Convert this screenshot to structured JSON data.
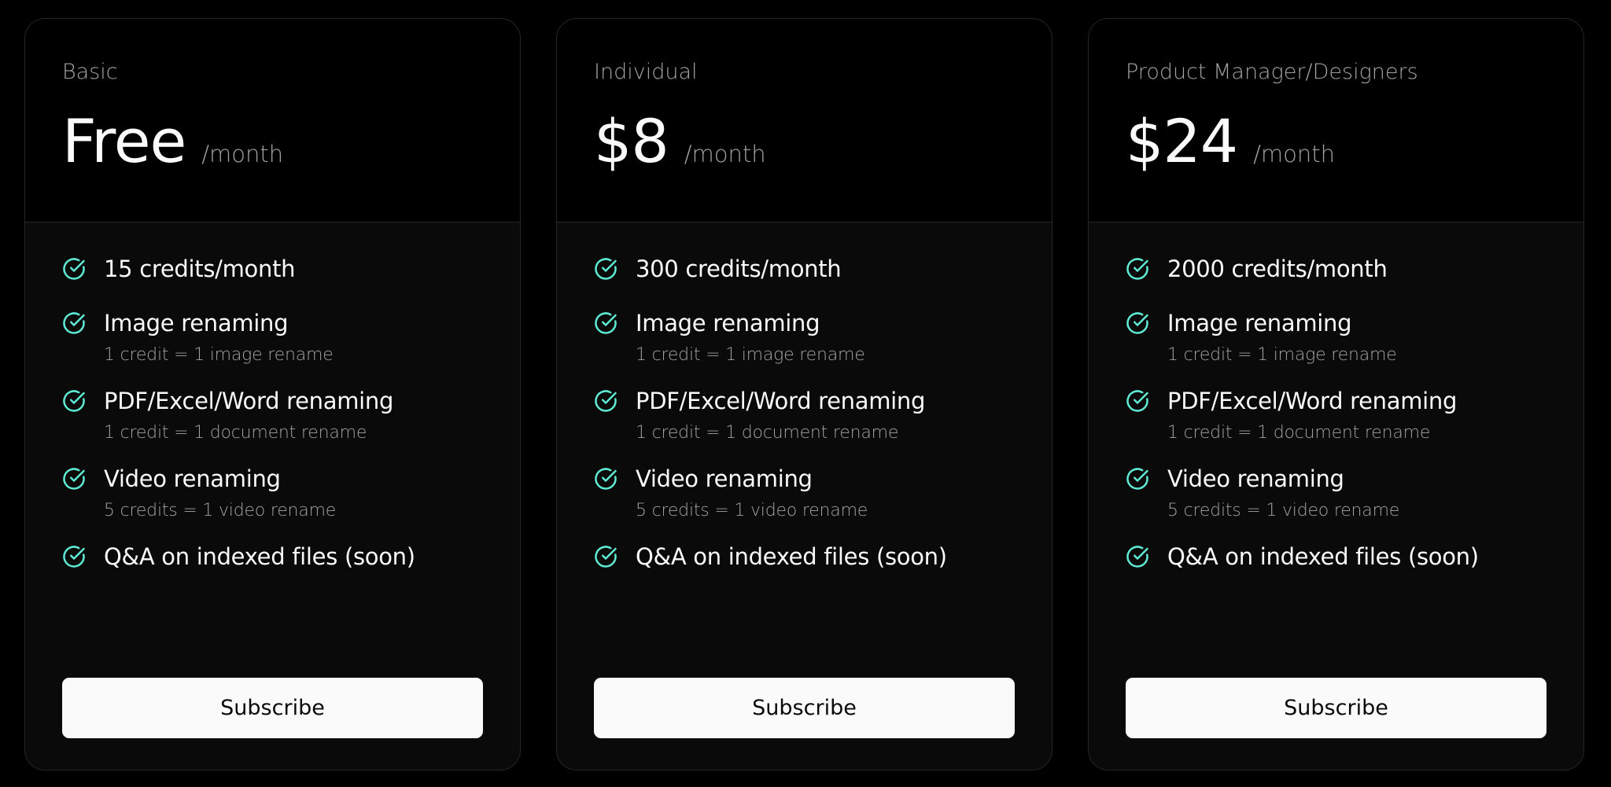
{
  "colors": {
    "page_background": "#000000",
    "card_background": "#0a0a0a",
    "card_border": "#262626",
    "check_accent": "#5eead4",
    "muted_text": "#a3a3a3",
    "button_background": "#fafafa"
  },
  "plans": [
    {
      "name": "Basic",
      "price": "Free",
      "period": "/month",
      "features": [
        {
          "label": "15 credits/month",
          "note": ""
        },
        {
          "label": "Image renaming",
          "note": "1 credit = 1 image rename"
        },
        {
          "label": "PDF/Excel/Word renaming",
          "note": "1 credit = 1 document rename"
        },
        {
          "label": "Video renaming",
          "note": "5 credits = 1 video rename"
        },
        {
          "label": "Q&A on indexed files (soon)",
          "note": ""
        }
      ],
      "cta": "Subscribe"
    },
    {
      "name": "Individual",
      "price": "$8",
      "period": "/month",
      "features": [
        {
          "label": "300 credits/month",
          "note": ""
        },
        {
          "label": "Image renaming",
          "note": "1 credit = 1 image rename"
        },
        {
          "label": "PDF/Excel/Word renaming",
          "note": "1 credit = 1 document rename"
        },
        {
          "label": "Video renaming",
          "note": "5 credits = 1 video rename"
        },
        {
          "label": "Q&A on indexed files (soon)",
          "note": ""
        }
      ],
      "cta": "Subscribe"
    },
    {
      "name": "Product Manager/Designers",
      "price": "$24",
      "period": "/month",
      "features": [
        {
          "label": "2000 credits/month",
          "note": ""
        },
        {
          "label": "Image renaming",
          "note": "1 credit = 1 image rename"
        },
        {
          "label": "PDF/Excel/Word renaming",
          "note": "1 credit = 1 document rename"
        },
        {
          "label": "Video renaming",
          "note": "5 credits = 1 video rename"
        },
        {
          "label": "Q&A on indexed files (soon)",
          "note": ""
        }
      ],
      "cta": "Subscribe"
    }
  ],
  "icons": {
    "feature_check": "circle-check-icon"
  }
}
